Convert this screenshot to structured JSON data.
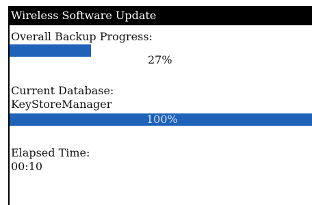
{
  "window": {
    "title": "Wireless Software Update"
  },
  "overall_backup": {
    "label": "Overall Backup Progress:",
    "progress_percent": 27,
    "progress_text": "27%"
  },
  "current_database": {
    "label": "Current Database:",
    "name": "KeyStoreManager",
    "progress_percent": 100,
    "progress_text": "100%"
  },
  "elapsed_time": {
    "label": "Elapsed Time:",
    "value": "00:10"
  },
  "colors": {
    "titlebar_background": "#000000",
    "titlebar_text": "#ffffff",
    "progress_fill": "#1f62b9",
    "body_background": "#ffffff",
    "body_text": "#111111",
    "full_bar_text": "#d4e2f6"
  }
}
